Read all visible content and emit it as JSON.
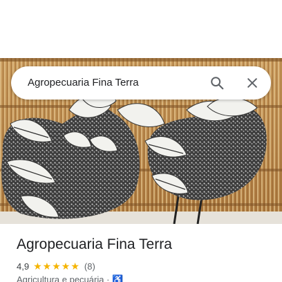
{
  "search": {
    "query": "Agropecuaria Fina Terra"
  },
  "place": {
    "name": "Agropecuaria Fina Terra",
    "rating": "4,9",
    "rating_value": 4.9,
    "max_stars": 5,
    "review_count": "(8)",
    "category": "Agricultura e pecuária",
    "separator": "·",
    "accessibility_icon": "wheelchair-icon"
  },
  "colors": {
    "star": "#f5b400",
    "text_primary": "#202124",
    "text_secondary": "#5f6368",
    "accent": "#1a73e8"
  },
  "icons": {
    "search": "search-icon",
    "close": "close-icon",
    "star": "star-icon"
  }
}
